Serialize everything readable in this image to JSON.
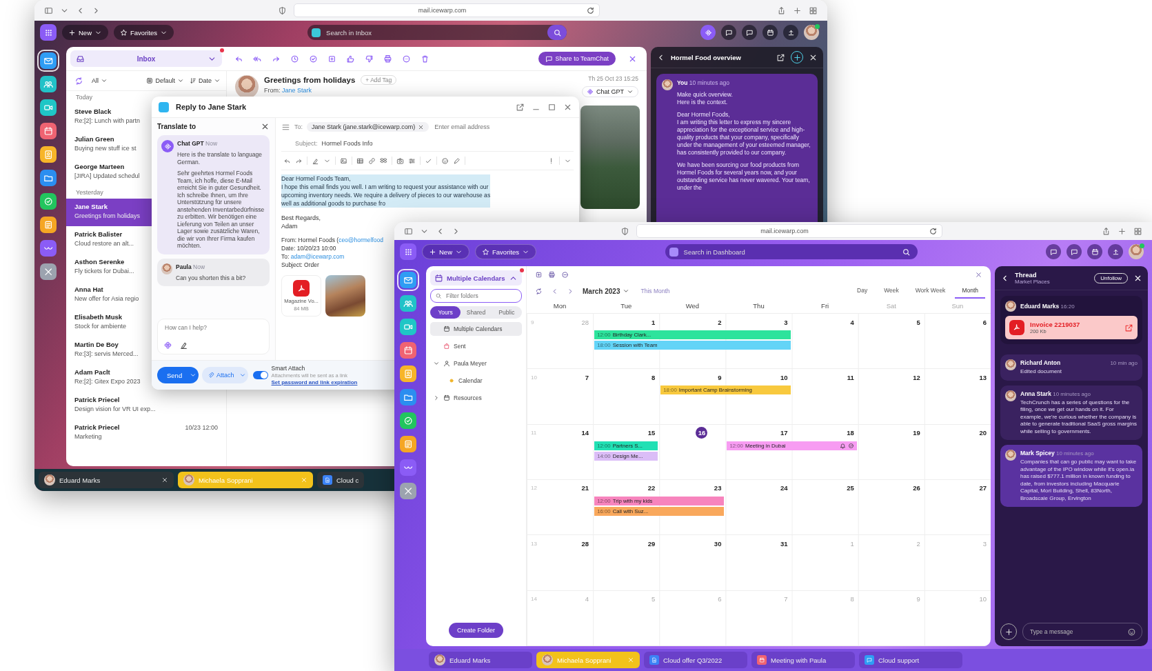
{
  "back_window": {
    "url": "mail.icewarp.com",
    "app_bar": {
      "new": "New",
      "favorites": "Favorites",
      "search_placeholder": "Search in Inbox"
    },
    "app_rail": [
      {
        "kind": "mail",
        "selected": true
      },
      {
        "kind": "contacts",
        "selected": false
      },
      {
        "kind": "video",
        "selected": false
      },
      {
        "kind": "calendar",
        "selected": false
      },
      {
        "kind": "notes",
        "selected": false
      },
      {
        "kind": "files",
        "selected": false
      },
      {
        "kind": "tasks",
        "selected": false
      },
      {
        "kind": "docs",
        "selected": false
      },
      {
        "kind": "heart",
        "selected": false
      },
      {
        "kind": "tools",
        "selected": false
      }
    ],
    "mail_toolbar": {
      "folder": "Inbox",
      "notification": true,
      "share": "Share to TeamChat"
    },
    "list_filters": {
      "scope": "All",
      "view": "Default",
      "sort": "Date"
    },
    "mail_groups": [
      {
        "label": "Today",
        "messages": [
          {
            "sender": "Steve Black",
            "preview": "Re:[2]: Lunch with partn",
            "selected": false
          },
          {
            "sender": "Julian Green",
            "preview": "Buying new stuff ice st",
            "selected": false
          },
          {
            "sender": "George Marteen",
            "preview": "[JIRA] Updated schedul",
            "selected": false
          }
        ]
      },
      {
        "label": "Yesterday",
        "messages": [
          {
            "sender": "Jane Stark",
            "preview": "Greetings from holidays",
            "selected": true
          },
          {
            "sender": "Patrick Balister",
            "preview": "Cloud restore an alt...",
            "selected": false
          },
          {
            "sender": "Asthon Serenke",
            "preview": "Fly tickets for Dubai...",
            "selected": false
          },
          {
            "sender": "Anna Hat",
            "preview": "New offer for Asia regio",
            "selected": false
          },
          {
            "sender": "Elisabeth Musk",
            "preview": "Stock for ambiente",
            "selected": false
          },
          {
            "sender": "Martin De Boy",
            "preview": "Re:[3]: servis Merced...",
            "selected": false
          },
          {
            "sender": "Adam Paclt",
            "preview": "Re:[2]: Gitex Expo 2023",
            "selected": false
          },
          {
            "sender": "Patrick Priecel",
            "preview": "Design vision for VR UI exp...",
            "selected": false
          },
          {
            "sender": "Patrick Priecel",
            "preview": "Marketing",
            "time": "10/23 12:00",
            "selected": false
          }
        ]
      }
    ],
    "message": {
      "subject": "Greetings from holidays",
      "add_tag": "+ Add Tag",
      "from_label": "From:",
      "from": "Jane Stark",
      "date": "Th 25 Oct 23 15:25",
      "assistant": "Chat GPT"
    },
    "reply_dialog": {
      "title": "Reply to Jane Stark",
      "translate": {
        "title": "Translate to",
        "messages": [
          {
            "kind": "bot",
            "author": "Chat GPT",
            "time": "Now",
            "paragraphs": [
              "Here is the translate to language German.",
              "Sehr geehrtes Hormel Foods Team, ich hoffe, diese E-Mail erreicht Sie in guter Gesundheit. Ich schreibe Ihnen, um Ihre Unterstützung für unsere anstehenden Inventarbedürfnisse zu erbitten. Wir benötigen eine Lieferung von Teilen an unser Lager sowie zusätzliche Waren, die wir von Ihrer Firma kaufen möchten."
            ]
          },
          {
            "kind": "user",
            "author": "Paula",
            "time": "Now",
            "paragraphs": [
              "Can you shorten this a bit?"
            ]
          }
        ],
        "placeholder": "How can I help?"
      },
      "compose": {
        "to_label": "To:",
        "recipient": "Jane Stark (jane.stark@icewarp.com)",
        "to_placeholder": "Enter email address",
        "subject_label": "Subject:",
        "subject": "Hormel Foods Info",
        "highlighted": "Dear Hormel Foods Team,\nI hope this email finds you well. I am writing to request your assistance with our\nupcoming inventory needs. We require a delivery of pieces to our warehouse as\nwell as additional goods to purchase fro",
        "signature": "Best Regards,\nAdam",
        "quoted": [
          {
            "text": "From: Hormel Foods (",
            "link": "ceo@hormelfood"
          },
          {
            "text": "Date: 10/20/23 10:00"
          },
          {
            "text": "To: ",
            "link": "adam@icewarp.com"
          },
          {
            "text": "Subject: Order"
          }
        ],
        "attachments": [
          {
            "kind": "pdf",
            "name": "Magazine Vo...",
            "size": "84 MB"
          },
          {
            "kind": "photo"
          }
        ]
      },
      "send": "Send",
      "attach": "Attach",
      "smart_attach": {
        "on": true,
        "title": "Smart Attach",
        "note": "Attachments will be sent as a link",
        "link": "Set password and link expiration"
      }
    },
    "ai_panel": {
      "title": "Hormel Food overview",
      "author": "You",
      "time": "10 minutes ago",
      "paragraphs": [
        "Make quick overview.\nHere is the context.",
        "Dear Hormel Foods,\nI am writing this letter to express my sincere appreciation for the exceptional service and high-quality products that your company, specifically under the management of your esteemed manager, has consistently provided to our company.",
        "We have been sourcing our food products from Hormel Foods for several years now, and your outstanding service has never wavered. Your team, under the"
      ]
    },
    "taskbar": [
      {
        "kind": "person",
        "label": "Eduard Marks",
        "selected": false,
        "closable": true
      },
      {
        "kind": "person",
        "label": "Michaela Sopprani",
        "selected": true,
        "closable": true
      },
      {
        "kind": "doc",
        "label": "Cloud c",
        "selected": false,
        "closable": false
      }
    ]
  },
  "front_window": {
    "url": "mail.icewarp.com",
    "app_bar": {
      "new": "New",
      "favorites": "Favorites",
      "search_placeholder": "Search in Dashboard"
    },
    "app_rail": [
      {
        "kind": "mail",
        "selected": true
      },
      {
        "kind": "contacts",
        "selected": false
      },
      {
        "kind": "video",
        "selected": false
      },
      {
        "kind": "calendar",
        "selected": false
      },
      {
        "kind": "notes",
        "selected": false
      },
      {
        "kind": "files",
        "selected": false
      },
      {
        "kind": "tasks",
        "selected": false
      },
      {
        "kind": "docs",
        "selected": false
      },
      {
        "kind": "heart",
        "selected": false
      },
      {
        "kind": "tools",
        "selected": false
      }
    ],
    "folders": {
      "title": "Multiple Calendars",
      "notification": true,
      "filter_placeholder": "Filter folders",
      "tabs": [
        {
          "label": "Yours",
          "selected": true
        },
        {
          "label": "Shared",
          "selected": false
        },
        {
          "label": "Public",
          "selected": false
        }
      ],
      "tree": [
        {
          "kind": "calendar",
          "label": "Multiple Calendars",
          "selected": true
        },
        {
          "kind": "sent",
          "label": "Sent",
          "selected": false
        },
        {
          "kind": "person",
          "label": "Paula Meyer",
          "selected": false,
          "expanded": true,
          "children": [
            {
              "kind": "dot",
              "label": "Calendar",
              "selected": false
            }
          ]
        },
        {
          "kind": "calendar",
          "label": "Resources",
          "selected": false,
          "expanded": false
        }
      ],
      "create": "Create Folder"
    },
    "calendar": {
      "month": "March 2023",
      "this_month": "This Month",
      "views": [
        {
          "label": "Day",
          "selected": false
        },
        {
          "label": "Week",
          "selected": false
        },
        {
          "label": "Work Week",
          "selected": false
        },
        {
          "label": "Month",
          "selected": true
        }
      ],
      "weekdays": [
        {
          "label": "Mon",
          "weekend": false
        },
        {
          "label": "Tue",
          "weekend": false
        },
        {
          "label": "Wed",
          "weekend": false
        },
        {
          "label": "Thu",
          "weekend": false
        },
        {
          "label": "Fri",
          "weekend": false
        },
        {
          "label": "Sat",
          "weekend": true
        },
        {
          "label": "Sun",
          "weekend": true
        }
      ],
      "weeks": [
        {
          "number": "9",
          "days": [
            {
              "label": "28",
              "kind": "outside"
            },
            {
              "label": "1",
              "kind": "day",
              "events": [
                {
                  "kind": "event",
                  "time": "12:00",
                  "title": "Birthday Clark...",
                  "color": "#2de39c",
                  "alarm": false,
                  "confirmed": false
                },
                {
                  "kind": "event",
                  "time": "18:00",
                  "title": "Session with Team",
                  "color": "#63d4f7",
                  "alarm": false,
                  "confirmed": false
                }
              ]
            },
            {
              "label": "2",
              "kind": "day",
              "events": [
                {
                  "kind": "continuation"
                }
              ]
            },
            {
              "label": "3",
              "kind": "day",
              "events": [
                {
                  "kind": "continuation"
                }
              ]
            },
            {
              "label": "4",
              "kind": "day"
            },
            {
              "label": "5",
              "kind": "day"
            },
            {
              "label": "6",
              "kind": "day"
            }
          ]
        },
        {
          "number": "10",
          "days": [
            {
              "label": "7",
              "kind": "day"
            },
            {
              "label": "8",
              "kind": "day"
            },
            {
              "label": "9",
              "kind": "day",
              "events": [
                {
                  "kind": "event",
                  "time": "18:00",
                  "title": "Important Camp Brainstorming",
                  "color": "#f8c93e",
                  "alarm": false,
                  "confirmed": false
                }
              ]
            },
            {
              "label": "10",
              "kind": "day",
              "events": [
                {
                  "kind": "continuation"
                }
              ]
            },
            {
              "label": "11",
              "kind": "day"
            },
            {
              "label": "12",
              "kind": "day"
            },
            {
              "label": "13",
              "kind": "day"
            }
          ]
        },
        {
          "number": "11",
          "days": [
            {
              "label": "14",
              "kind": "day"
            },
            {
              "label": "15",
              "kind": "day",
              "events": [
                {
                  "kind": "event",
                  "time": "12:00",
                  "title": "Partners S...",
                  "color": "#22e0b4",
                  "alarm": false,
                  "confirmed": false
                },
                {
                  "kind": "event",
                  "time": "14:00",
                  "title": "Design Me...",
                  "color": "#dbbdf7",
                  "alarm": false,
                  "confirmed": false
                }
              ]
            },
            {
              "label": "16",
              "kind": "today"
            },
            {
              "label": "17",
              "kind": "day",
              "events": [
                {
                  "kind": "event",
                  "time": "12:00",
                  "title": "Meeting in Dubai",
                  "color": "#f79cf2",
                  "alarm": true,
                  "confirmed": true
                }
              ]
            },
            {
              "label": "18",
              "kind": "day",
              "events": [
                {
                  "kind": "continuation"
                }
              ]
            },
            {
              "label": "19",
              "kind": "day"
            },
            {
              "label": "20",
              "kind": "day"
            }
          ]
        },
        {
          "number": "12",
          "days": [
            {
              "label": "21",
              "kind": "day"
            },
            {
              "label": "22",
              "kind": "day",
              "events": [
                {
                  "kind": "event",
                  "time": "12:00",
                  "title": "Trip with my kids",
                  "color": "#f784bd",
                  "alarm": false,
                  "confirmed": false
                },
                {
                  "kind": "event",
                  "time": "16:00",
                  "title": "Call with Suz...",
                  "color": "#f9a85c",
                  "alarm": false,
                  "confirmed": false
                }
              ]
            },
            {
              "label": "23",
              "kind": "day",
              "events": [
                {
                  "kind": "continuation"
                }
              ]
            },
            {
              "label": "24",
              "kind": "day"
            },
            {
              "label": "25",
              "kind": "day"
            },
            {
              "label": "26",
              "kind": "day"
            },
            {
              "label": "27",
              "kind": "day"
            }
          ]
        },
        {
          "number": "13",
          "days": [
            {
              "label": "28",
              "kind": "day"
            },
            {
              "label": "29",
              "kind": "day"
            },
            {
              "label": "30",
              "kind": "day"
            },
            {
              "label": "31",
              "kind": "day"
            },
            {
              "label": "1",
              "kind": "outside"
            },
            {
              "label": "2",
              "kind": "outside"
            },
            {
              "label": "3",
              "kind": "outside"
            }
          ]
        },
        {
          "number": "14",
          "days": [
            {
              "label": "4",
              "kind": "outside"
            },
            {
              "label": "5",
              "kind": "outside"
            },
            {
              "label": "6",
              "kind": "outside"
            },
            {
              "label": "7",
              "kind": "outside"
            },
            {
              "label": "8",
              "kind": "outside"
            },
            {
              "label": "9",
              "kind": "outside"
            },
            {
              "label": "10",
              "kind": "outside"
            }
          ]
        }
      ]
    },
    "thread": {
      "title": "Thread",
      "subtitle": "Market Places",
      "unfollow": "Unfollow",
      "messages": [
        {
          "kind": "attachment",
          "author": "Eduard Marks",
          "time": "16:20",
          "file": "Invoice 2219037",
          "size": "200 Kb",
          "highlighted": false
        },
        {
          "kind": "activity",
          "author": "Richard Anton",
          "time": "10 min ago",
          "text": "Edited document",
          "highlighted": false
        },
        {
          "kind": "message",
          "author": "Anna Stark",
          "time": "10 minutes ago",
          "text": "TechCrunch has a series of questions for the filing, once we get our hands on it. For example, we're curious whether the company is able to generate traditional SaaS gross margins while selling to governments.",
          "highlighted": false
        },
        {
          "kind": "message",
          "author": "Mark Spicey",
          "time": "10 minutes ago",
          "text": "Companies that can go public may want to take advantage of the IPO window while it's open.ia has raised $777.1 million in known funding to date, from investors including Macquarie Capital, Mori Building, Shell, 83North, Broadscale Group, Ervington",
          "highlighted": true
        }
      ],
      "placeholder": "Type a message"
    },
    "taskbar": [
      {
        "kind": "person",
        "label": "Eduard Marks",
        "selected": false,
        "closable": false
      },
      {
        "kind": "person",
        "label": "Michaela Sopprani",
        "selected": true,
        "closable": true
      },
      {
        "kind": "doc",
        "label": "Cloud offer Q3/2022",
        "selected": false,
        "closable": false
      },
      {
        "kind": "calendar",
        "label": "Meeting with Paula",
        "selected": false,
        "closable": false
      },
      {
        "kind": "chat",
        "label": "Cloud support",
        "selected": false,
        "closable": false
      }
    ]
  }
}
